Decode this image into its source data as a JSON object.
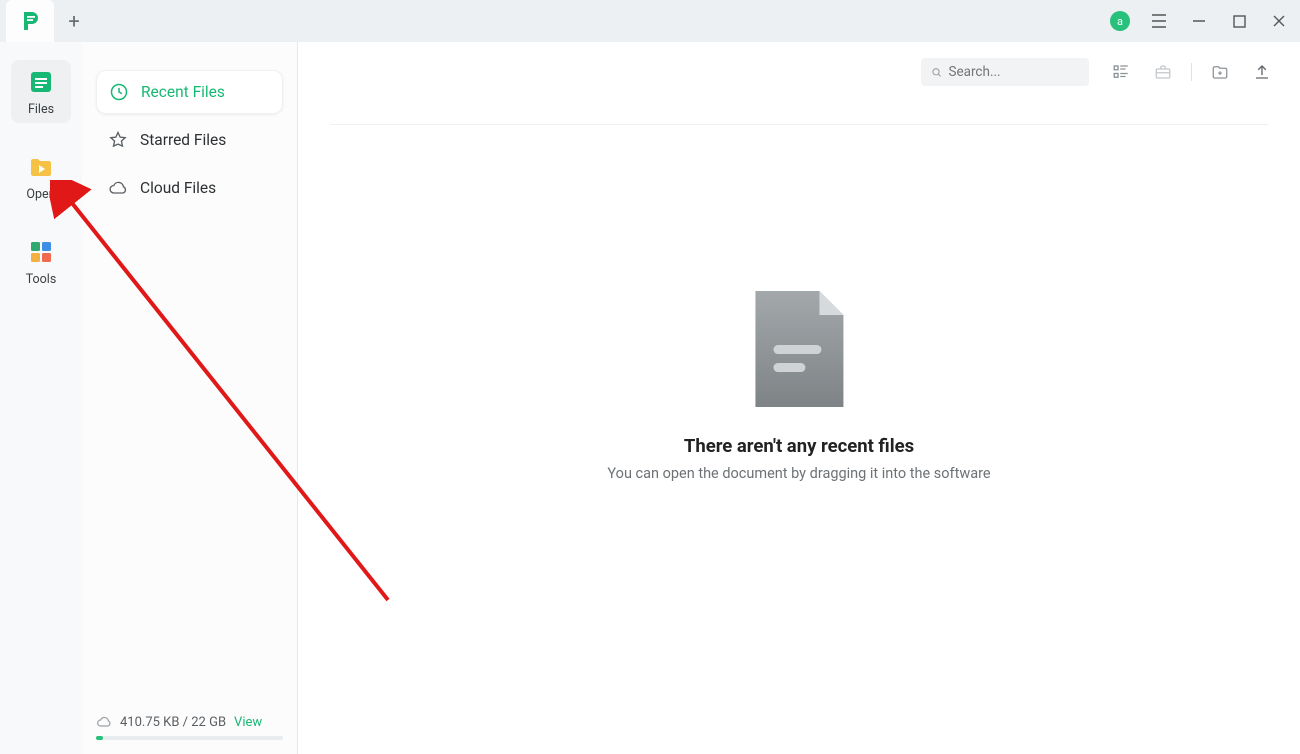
{
  "titlebar": {
    "avatar_letter": "a"
  },
  "icon_sidebar": {
    "files": "Files",
    "open": "Open",
    "tools": "Tools"
  },
  "list_sidebar": {
    "recent": "Recent Files",
    "starred": "Starred Files",
    "cloud": "Cloud Files"
  },
  "storage": {
    "text": "410.75 KB / 22 GB",
    "view": "View"
  },
  "toolbar": {
    "search_placeholder": "Search..."
  },
  "empty": {
    "title": "There aren't any recent files",
    "subtitle": "You can open the document by dragging it into the software"
  }
}
